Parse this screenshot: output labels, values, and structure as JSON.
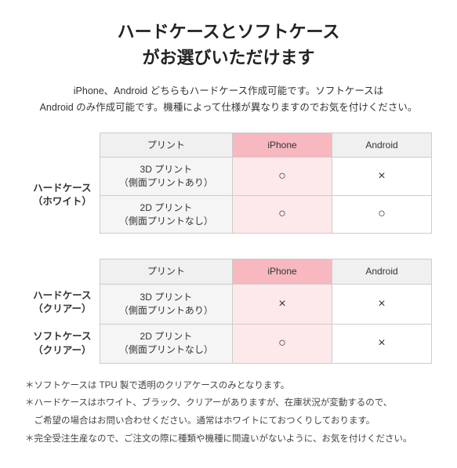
{
  "title": {
    "line1": "ハードケースとソフトケース",
    "line2": "がお選びいただけます"
  },
  "description": "iPhone、Android どちらもハードケース作成可能です。ソフトケースは\nAndroid のみ作成可能です。機種によって仕様が異なりますのでお気を付けください。",
  "table1": {
    "rowLabel": "ハードケース\n（ホワイト）",
    "columns": {
      "print": "プリント",
      "iphone": "iPhone",
      "android": "Android"
    },
    "rows": [
      {
        "print": "3D プリント\n（側面プリントあり）",
        "iphone": "○",
        "android": "×"
      },
      {
        "print": "2D プリント\n（側面プリントなし）",
        "iphone": "○",
        "android": "○"
      }
    ]
  },
  "table2": {
    "rowLabel1": "ハードケース\n（クリアー）",
    "rowLabel2": "ソフトケース\n（クリアー）",
    "columns": {
      "print": "プリント",
      "iphone": "iPhone",
      "android": "Android"
    },
    "rows": [
      {
        "print": "3D プリント\n（側面プリントあり）",
        "iphone": "×",
        "android": "×"
      },
      {
        "print": "2D プリント\n（側面プリントなし）",
        "iphone": "○",
        "android": "×"
      }
    ]
  },
  "notes": [
    "＊ソフトケースは TPU 製で透明のクリアケースのみとなります。",
    "＊ハードケースはホワイト、ブラック、クリアーがありますが、在庫状況が変動するので、",
    "　ご希望の場合はお問い合わせください。通常はホワイトにておつくりしております。",
    "＊完全受注生産なので、ご注文の際に種類や機種に間違いがないように、お気を付けください。"
  ]
}
